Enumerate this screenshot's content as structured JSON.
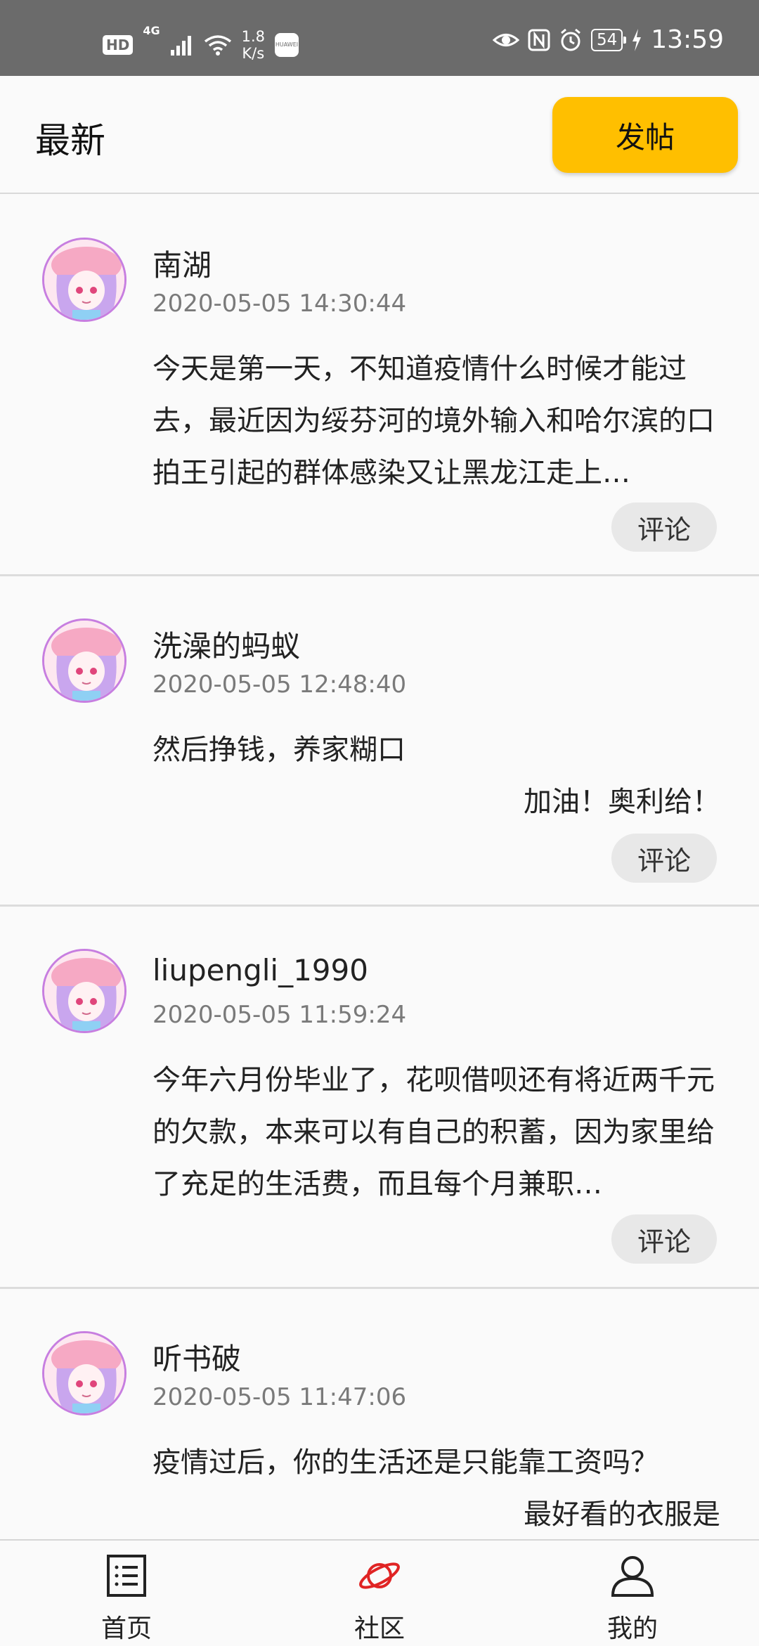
{
  "status_bar": {
    "hd": "HD",
    "network": "4G",
    "speed_value": "1.8",
    "speed_unit": "K/s",
    "app_badge": "HUAWEI",
    "battery": "54",
    "time": "13:59"
  },
  "header": {
    "title": "最新",
    "post_button": "发帖"
  },
  "posts": [
    {
      "username": "南湖",
      "time": "2020-05-05 14:30:44",
      "content": "今天是第一天，不知道疫情什么时候才能过去，最近因为绥芬河的境外输入和哈尔滨的口拍王引起的群体感染又让黑龙江走上…",
      "content_extra": "",
      "comment_label": "评论"
    },
    {
      "username": "洗澡的蚂蚁",
      "time": "2020-05-05 12:48:40",
      "content": "然后挣钱，养家糊口",
      "content_extra": "加油！奥利给！",
      "comment_label": "评论"
    },
    {
      "username": "liupengli_1990",
      "time": "2020-05-05 11:59:24",
      "content": "今年六月份毕业了，花呗借呗还有将近两千元的欠款，本来可以有自己的积蓄，因为家里给了充足的生活费，而且每个月兼职…",
      "content_extra": "",
      "comment_label": "评论"
    },
    {
      "username": "听书破",
      "time": "2020-05-05 11:47:06",
      "content": "疫情过后，你的生活还是只能靠工资吗？",
      "content_extra": "最好看的衣服是",
      "comment_label": ""
    }
  ],
  "bottom_nav": [
    {
      "label": "首页",
      "icon": "list-icon"
    },
    {
      "label": "社区",
      "icon": "planet-icon",
      "active": true
    },
    {
      "label": "我的",
      "icon": "user-icon"
    }
  ],
  "colors": {
    "accent": "#ffbf00",
    "active_nav": "#e02424",
    "status_bar": "#6b6b6b"
  }
}
